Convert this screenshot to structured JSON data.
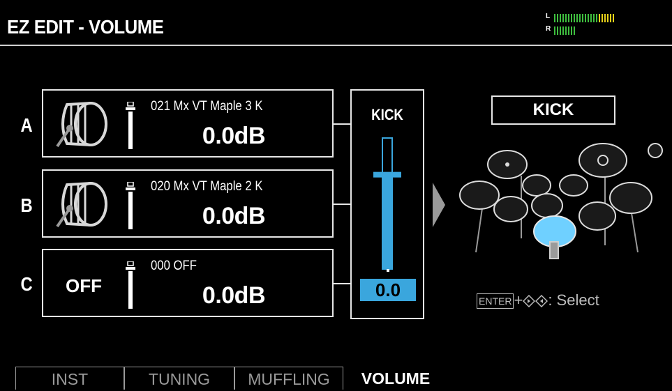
{
  "header": {
    "title": "EZ EDIT - VOLUME",
    "meter_left_label": "L",
    "meter_right_label": "R"
  },
  "slots": [
    {
      "letter": "A",
      "instrument": "021 Mx VT Maple 3 K",
      "level": "0.0dB",
      "icon": "kick-drum-icon"
    },
    {
      "letter": "B",
      "instrument": "020 Mx VT Maple 2 K",
      "level": "0.0dB",
      "icon": "kick-drum-icon"
    },
    {
      "letter": "C",
      "instrument": "000 OFF",
      "level": "0.0dB",
      "icon_text": "OFF"
    }
  ],
  "mix": {
    "title": "KICK",
    "value": "0.0",
    "fader_level": 0.72
  },
  "kit": {
    "selected_pad": "KICK"
  },
  "hint": {
    "key": "ENTER",
    "plus": "+",
    "action": ": Select"
  },
  "tabs": [
    {
      "label": "INST",
      "active": false
    },
    {
      "label": "TUNING",
      "active": false
    },
    {
      "label": "MUFFLING",
      "active": false
    },
    {
      "label": "VOLUME",
      "active": true
    }
  ],
  "colors": {
    "accent": "#3aa6dd",
    "meter_green": "#3fbf3f",
    "meter_yellow": "#e8d21a"
  }
}
